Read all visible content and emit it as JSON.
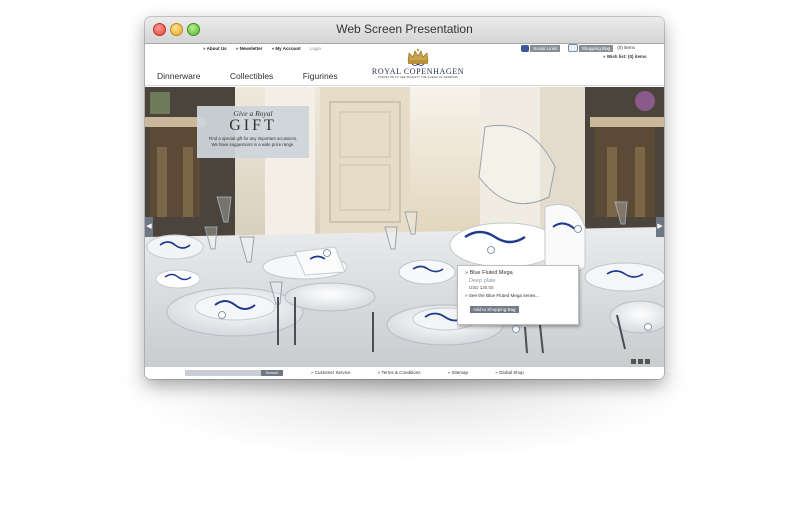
{
  "window": {
    "title": "Web Screen Presentation"
  },
  "header": {
    "links": [
      "» About Us",
      "» Newsletter",
      "» My Account"
    ],
    "login": "Login",
    "social_label": "Social Links",
    "bag_label": "Shopping Bag",
    "bag_items": "(0) items",
    "wishlist": "» Wish list: (0) items"
  },
  "nav": {
    "items": [
      "Dinnerware",
      "Collectibles",
      "Figurines"
    ]
  },
  "brand": {
    "name": "ROYAL COPENHAGEN",
    "tagline": "PURVEYOR TO HER MAJESTY THE QUEEN OF DENMARK"
  },
  "hero": {
    "gift_line1": "Give a Royal",
    "gift_line2": "GIFT",
    "gift_text": "Find a special gift for any important occasions. We have suggestions in a wide price range.",
    "arrow_left": "◀",
    "arrow_right": "▶"
  },
  "popup": {
    "name": "» Blue Fluted Mega",
    "subtitle": "Deep plate",
    "price": "USD   130.00",
    "link": "» See the Blue Fluted Mega series...",
    "button": "Add to Shopping Bag"
  },
  "footer": {
    "search_button": "Search",
    "links": [
      "» Customer Service",
      "» Terms & Conditions",
      "» Sitemap",
      "» Global Shop"
    ]
  },
  "colors": {
    "accent_blue": "#1e3a8c",
    "button_grey": "#6f7782"
  }
}
